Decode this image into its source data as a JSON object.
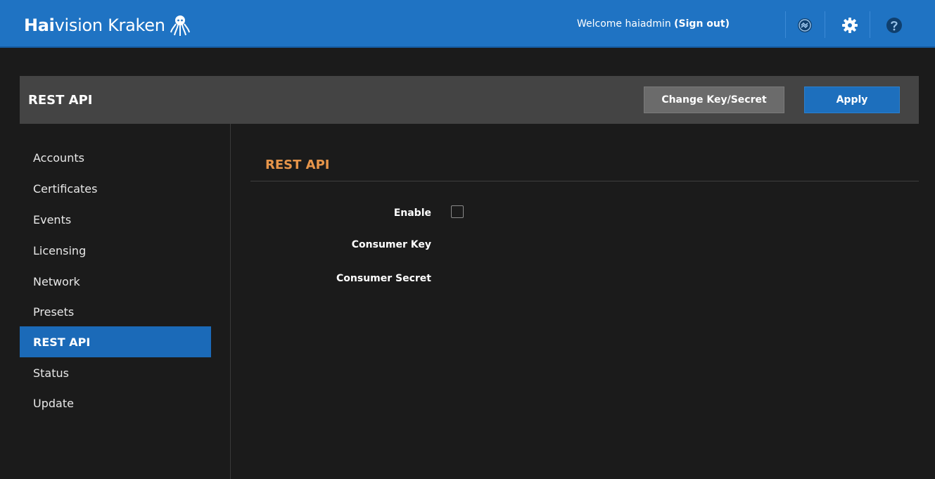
{
  "app": {
    "brand_bold": "Hai",
    "brand_light": "vision Kraken",
    "welcome_prefix": "Welcome haiadmin ",
    "sign_out": "(Sign out)"
  },
  "header": {
    "title": "REST API",
    "change_key_label": "Change Key/Secret",
    "apply_label": "Apply"
  },
  "sidebar": {
    "items": [
      {
        "label": "Accounts"
      },
      {
        "label": "Certificates"
      },
      {
        "label": "Events"
      },
      {
        "label": "Licensing"
      },
      {
        "label": "Network"
      },
      {
        "label": "Presets"
      },
      {
        "label": "REST API",
        "active": true
      },
      {
        "label": "Status"
      },
      {
        "label": "Update"
      }
    ]
  },
  "main": {
    "section_title": "REST API",
    "fields": {
      "enable_label": "Enable",
      "enable_checked": false,
      "consumer_key_label": "Consumer Key",
      "consumer_secret_label": "Consumer Secret"
    }
  },
  "icons": {
    "kraken_logo": "octopus-logo",
    "status": "status-icon",
    "settings": "gear-icon",
    "help": "help-icon"
  },
  "colors": {
    "topbar": "#1f73c3",
    "accent": "#1b6ab8",
    "section_title": "#e7954a",
    "background": "#1b1b1b"
  }
}
